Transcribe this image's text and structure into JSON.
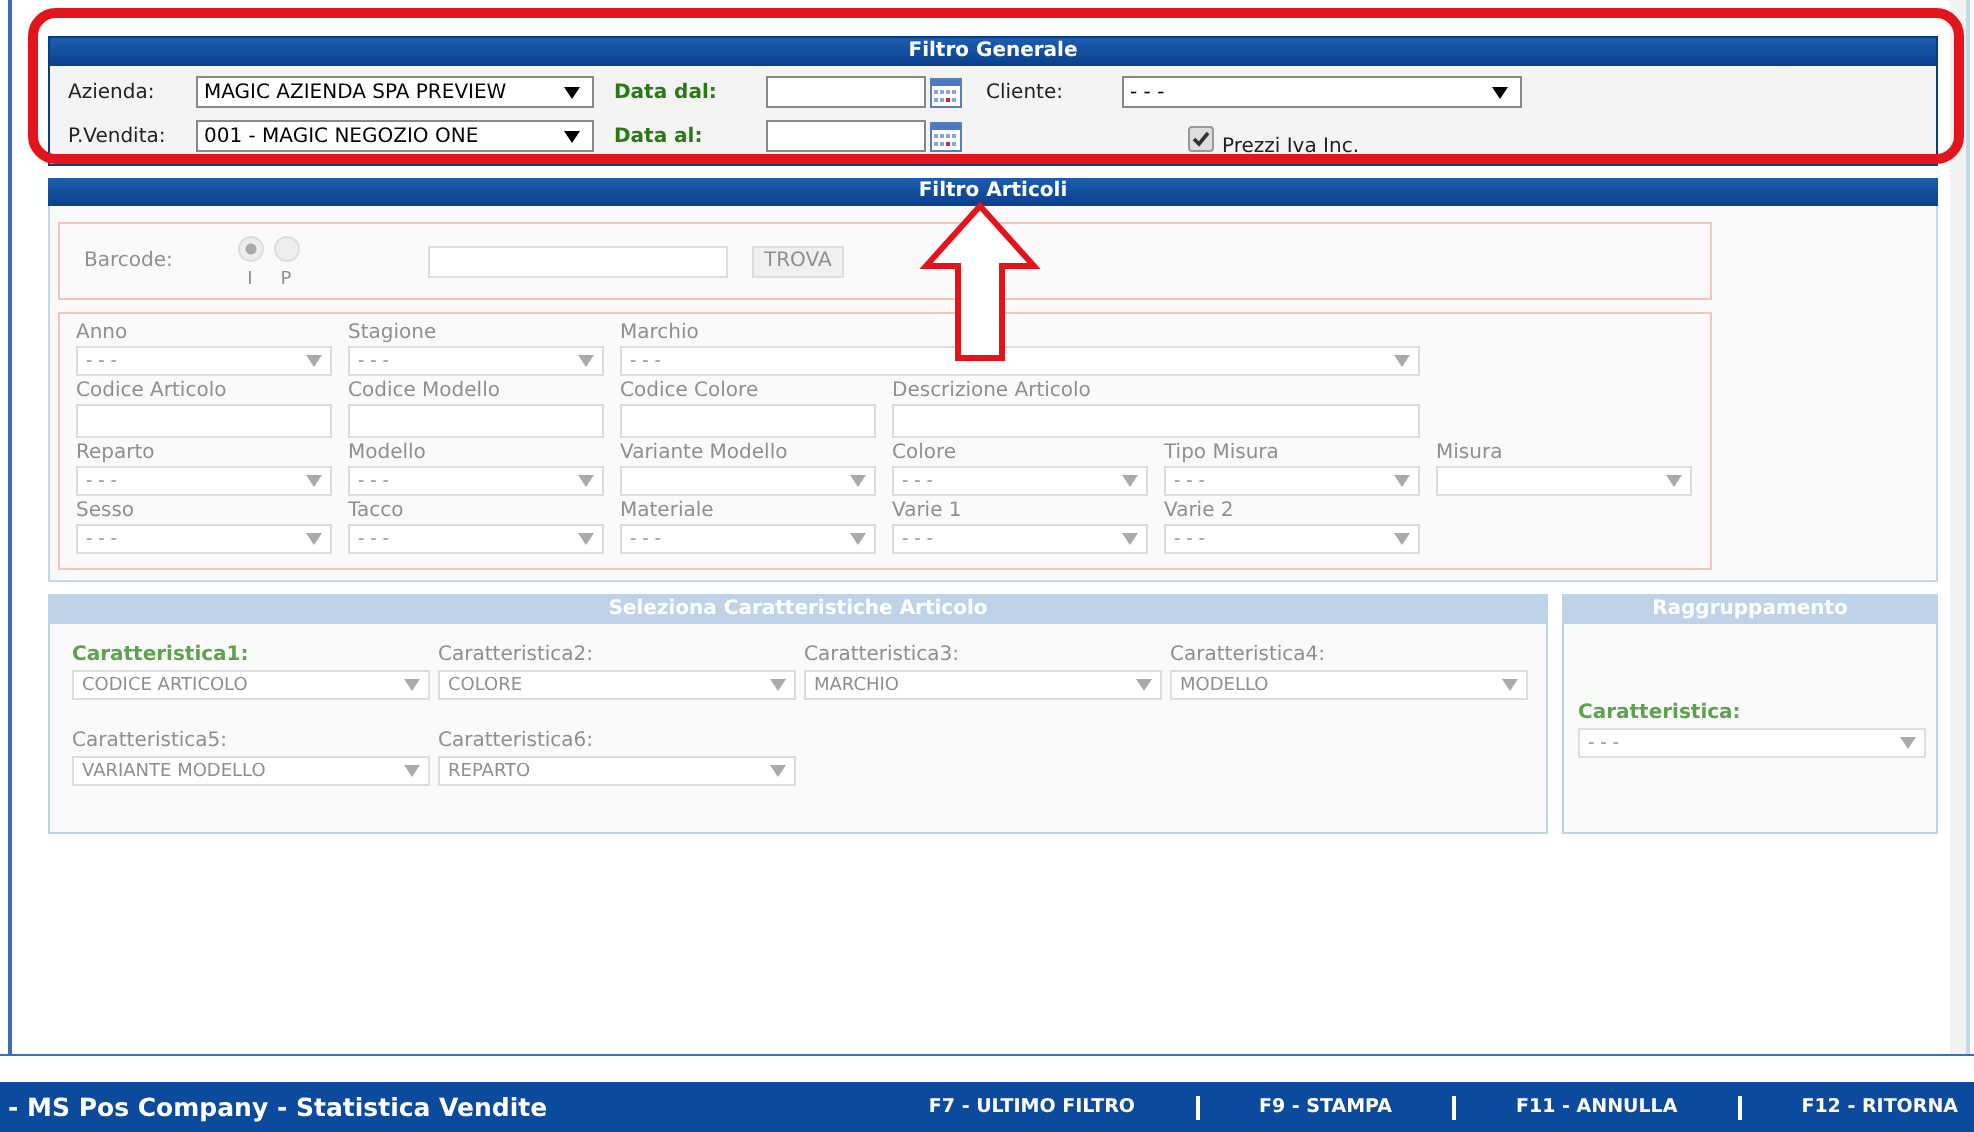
{
  "filtro_generale": {
    "title": "Filtro Generale",
    "azienda": {
      "label": "Azienda:",
      "value": "MAGIC AZIENDA SPA PREVIEW"
    },
    "punto_vendita": {
      "label": "P.Vendita:",
      "value": "001 - MAGIC NEGOZIO ONE"
    },
    "data_dal": {
      "label": "Data dal:"
    },
    "data_al": {
      "label": "Data al:"
    },
    "cliente": {
      "label": "Cliente:",
      "value": "- - -"
    },
    "prezzi_iva": {
      "label": "Prezzi Iva Inc.",
      "checked": true
    }
  },
  "filtro_articoli": {
    "title": "Filtro Articoli",
    "disabled": true,
    "barcode": {
      "label": "Barcode:",
      "options": [
        {
          "label": "I",
          "selected": true
        },
        {
          "label": "P",
          "selected": false
        }
      ],
      "button": "TROVA"
    },
    "rows": [
      [
        {
          "label": "Anno",
          "kind": "select",
          "value": "- - -"
        },
        {
          "label": "Stagione",
          "kind": "select",
          "value": "- - -"
        },
        {
          "label": "Marchio",
          "kind": "select",
          "value": "- - -"
        }
      ],
      [
        {
          "label": "Codice Articolo",
          "kind": "input"
        },
        {
          "label": "Codice Modello",
          "kind": "input"
        },
        {
          "label": "Codice Colore",
          "kind": "input"
        },
        {
          "label": "Descrizione Articolo",
          "kind": "input"
        }
      ],
      [
        {
          "label": "Reparto",
          "kind": "select",
          "value": "- - -"
        },
        {
          "label": "Modello",
          "kind": "select",
          "value": "- - -"
        },
        {
          "label": "Variante Modello",
          "kind": "select"
        },
        {
          "label": "Colore",
          "kind": "select",
          "value": "- - -"
        },
        {
          "label": "Tipo Misura",
          "kind": "select",
          "value": "- - -"
        },
        {
          "label": "Misura",
          "kind": "select"
        }
      ],
      [
        {
          "label": "Sesso",
          "kind": "select",
          "value": "- - -"
        },
        {
          "label": "Tacco",
          "kind": "select",
          "value": "- - -"
        },
        {
          "label": "Materiale",
          "kind": "select",
          "value": "- - -"
        },
        {
          "label": "Varie 1",
          "kind": "select",
          "value": "- - -"
        },
        {
          "label": "Varie 2",
          "kind": "select",
          "value": "- - -"
        }
      ]
    ]
  },
  "caratteristiche": {
    "title": "Seleziona Caratteristiche Articolo",
    "disabled": true,
    "items": [
      {
        "label": "Caratteristica1:",
        "value": "CODICE ARTICOLO",
        "required": true
      },
      {
        "label": "Caratteristica2:",
        "value": "COLORE",
        "required": false
      },
      {
        "label": "Caratteristica3:",
        "value": "MARCHIO",
        "required": false
      },
      {
        "label": "Caratteristica4:",
        "value": "MODELLO",
        "required": false
      },
      {
        "label": "Caratteristica5:",
        "value": "VARIANTE MODELLO",
        "required": false
      },
      {
        "label": "Caratteristica6:",
        "value": "REPARTO",
        "required": false
      }
    ]
  },
  "raggruppamento": {
    "title": "Raggruppamento",
    "disabled": true,
    "label": "Caratteristica:",
    "value": "- - -",
    "required": true
  },
  "status_bar": {
    "title": "- MS Pos Company - Statistica Vendite",
    "keys": [
      "F7 - ULTIMO FILTRO",
      "F9 - STAMPA",
      "F11 - ANNULLA",
      "F12 - RITORNA"
    ]
  }
}
